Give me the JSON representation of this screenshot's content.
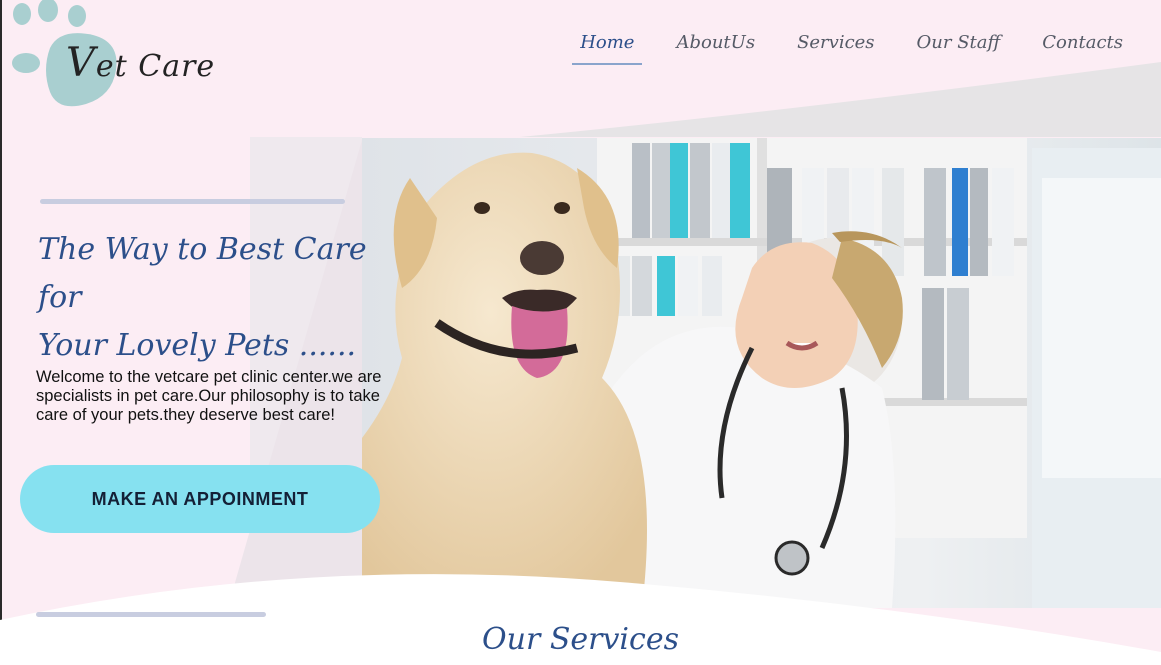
{
  "brand": {
    "logo_v": "V",
    "logo_rest": "et Care"
  },
  "nav": {
    "items": [
      {
        "label": "Home",
        "active": true
      },
      {
        "label": "AboutUs",
        "active": false
      },
      {
        "label": "Services",
        "active": false
      },
      {
        "label": "Our Staff",
        "active": false
      },
      {
        "label": "Contacts",
        "active": false
      }
    ]
  },
  "hero": {
    "title_line1": "The Way to Best Care for",
    "title_line2": "Your Lovely Pets ......",
    "description": "Welcome to the vetcare pet clinic center.we are specialists in pet care.Our philosophy is to take care of your pets.they deserve best care!",
    "cta_label": "MAKE AN APPOINMENT",
    "image_alt": "veterinarian-with-labrador-photo"
  },
  "services": {
    "title": "Our Services"
  },
  "colors": {
    "page_bg": "#fcedf4",
    "accent_blue": "#2c4f8a",
    "cta_bg": "#86e1f0",
    "paw_color": "#a9cfd0"
  }
}
